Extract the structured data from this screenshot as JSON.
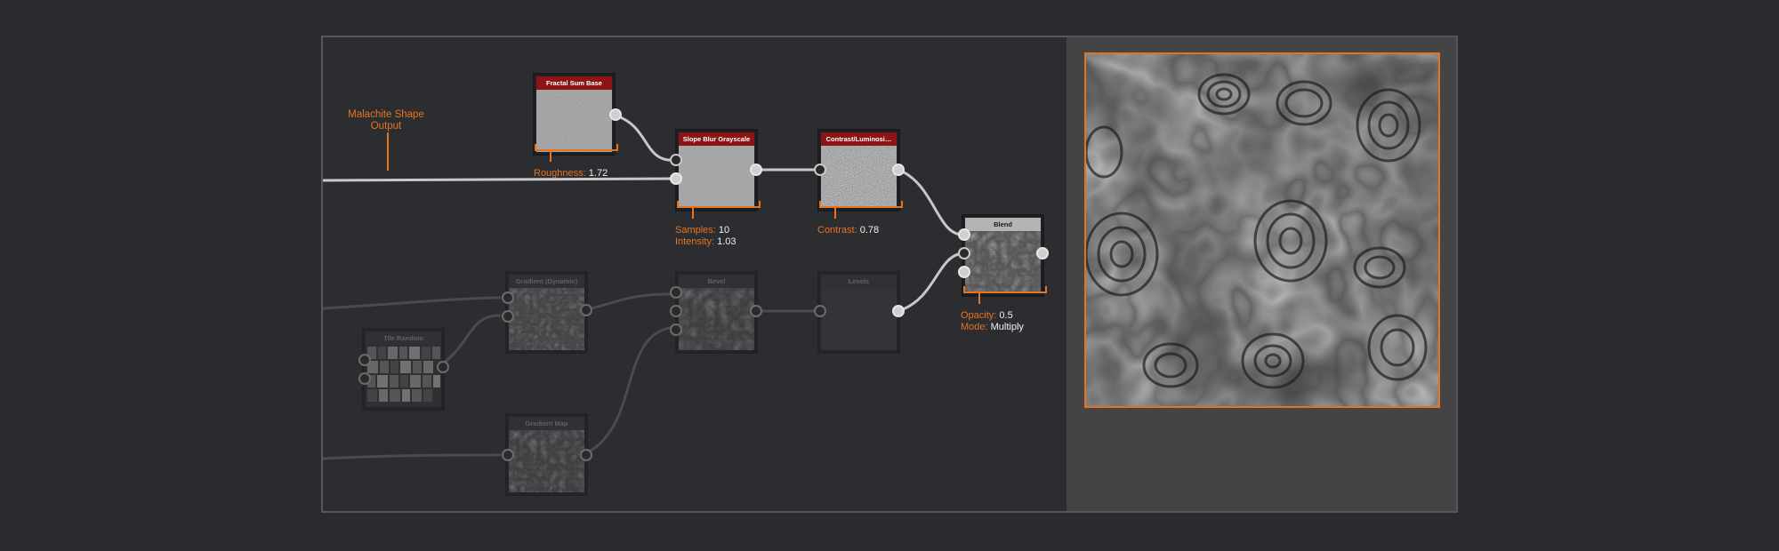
{
  "graph": {
    "frame_label": "Malachite Shape\nOutput",
    "nodes": [
      {
        "id": "fractal-sum-base",
        "title": "Fractal Sum Base",
        "params": [
          {
            "label": "Roughness:",
            "value": "1.72"
          }
        ]
      },
      {
        "id": "slope-blur-grayscale",
        "title": "Slope Blur Grayscale",
        "params": [
          {
            "label": "Samples:",
            "value": "10"
          },
          {
            "label": "Intensity:",
            "value": "1.03"
          }
        ]
      },
      {
        "id": "contrast-luminosity",
        "title": "Contrast/Luminosi…",
        "params": [
          {
            "label": "Contrast:",
            "value": "0.78"
          }
        ]
      },
      {
        "id": "blend",
        "title": "Blend",
        "params": [
          {
            "label": "Opacity:",
            "value": "0.5"
          },
          {
            "label": "Mode:",
            "value": "Multiply"
          }
        ]
      },
      {
        "id": "gradient-dynamic",
        "title": "Gradient (Dynamic)"
      },
      {
        "id": "bevel",
        "title": "Bevel"
      },
      {
        "id": "levels",
        "title": "Levels"
      },
      {
        "id": "tile-random",
        "title": "Tile Random"
      },
      {
        "id": "gradient-map",
        "title": "Gradient Map"
      }
    ]
  },
  "colors": {
    "accent": "#e8731e",
    "node_header_active": "#8d1414",
    "node_header_blend": "#b4b4b4"
  }
}
